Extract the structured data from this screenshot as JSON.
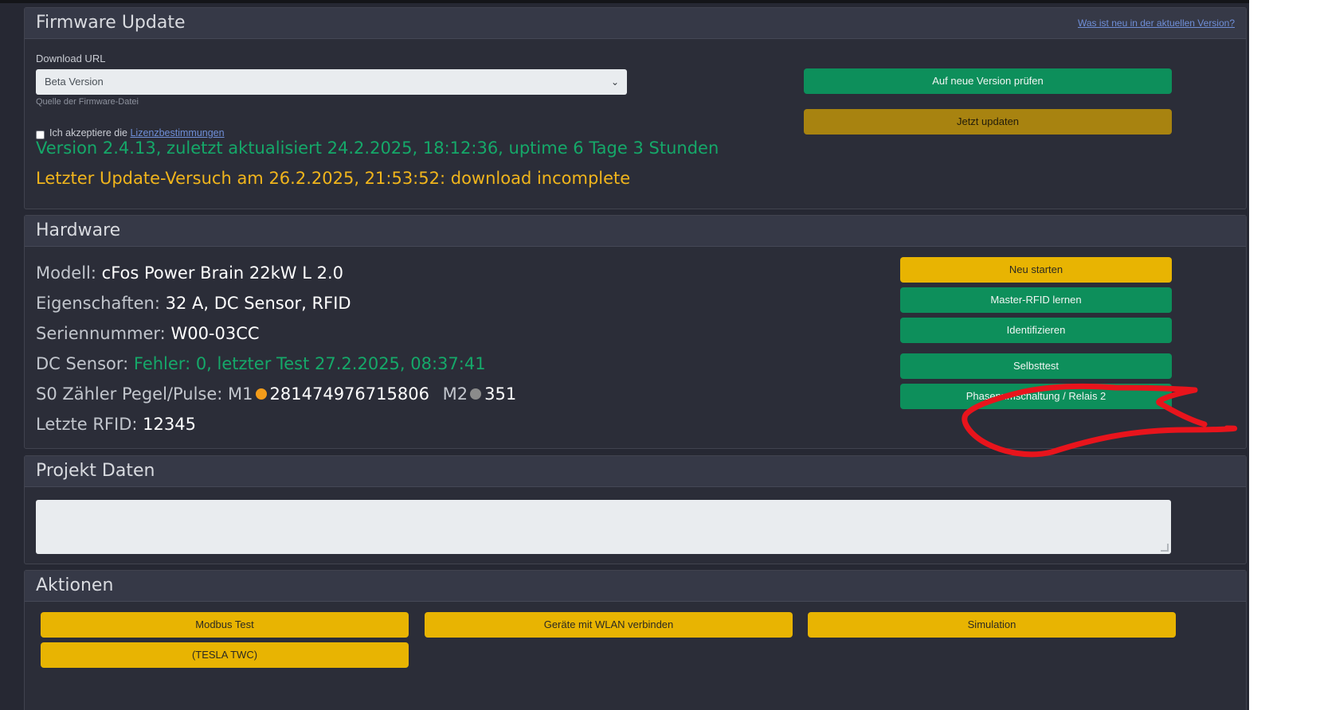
{
  "firmware": {
    "title": "Firmware Update",
    "whats_new_link": "Was ist neu in der aktuellen Version?",
    "download_url_label": "Download URL",
    "download_select_value": "Beta Version",
    "download_help": "Quelle der Firmware-Datei",
    "accept_text": "Ich akzeptiere die",
    "license_link": "Lizenzbestimmungen",
    "version_status": "Version 2.4.13, zuletzt aktualisiert 24.2.2025, 18:12:36, uptime 6 Tage 3 Stunden",
    "last_update_status": "Letzter Update-Versuch am 26.2.2025, 21:53:52: download incomplete",
    "check_button": "Auf neue Version prüfen",
    "update_button": "Jetzt updaten"
  },
  "hardware": {
    "title": "Hardware",
    "model_label": "Modell:",
    "model_value": "cFos Power Brain 22kW L 2.0",
    "props_label": "Eigenschaften:",
    "props_value": "32 A, DC Sensor, RFID",
    "serial_label": "Seriennummer:",
    "serial_value": "W00-03CC",
    "dc_label": "DC Sensor:",
    "dc_value": "Fehler: 0, letzter Test 27.2.2025, 08:37:41",
    "s0_label": "S0 Zähler Pegel/Pulse: M1",
    "m1_value": "281474976715806",
    "m2_label": "M2",
    "m2_value": "351",
    "rfid_label": "Letzte RFID:",
    "rfid_value": "12345",
    "buttons": {
      "restart": "Neu starten",
      "master_rfid": "Master-RFID lernen",
      "identify": "Identifizieren",
      "selftest": "Selbsttest",
      "phase_switch": "Phasenumschaltung / Relais 2"
    }
  },
  "project": {
    "title": "Projekt Daten",
    "textarea_value": ""
  },
  "actions": {
    "title": "Aktionen",
    "buttons": [
      "Modbus Test",
      "Geräte mit WLAN verbinden",
      "Simulation",
      "(TESLA TWC)"
    ]
  },
  "colors": {
    "background": "#262833",
    "card": "#2b2d38",
    "green": "#0d8f5b",
    "yellow": "#e8b402",
    "olive": "#a88310",
    "status_green": "#15a869",
    "status_amber": "#f1b51c",
    "annotation_red": "#e8141c"
  }
}
